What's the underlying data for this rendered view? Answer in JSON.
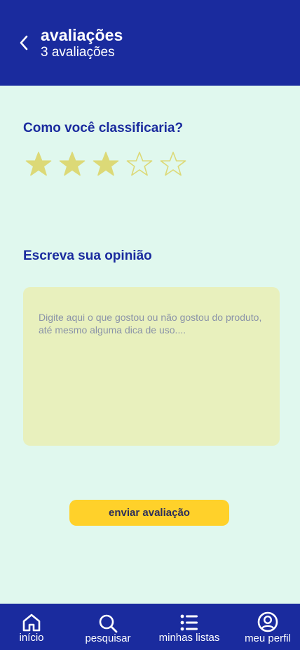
{
  "header": {
    "title": "avaliações",
    "subtitle": "3 avaliações"
  },
  "rating": {
    "question": "Como você classificaria?",
    "value": 3,
    "max": 5,
    "filled_color": "#DCD977",
    "empty_color": "#DCD977"
  },
  "opinion": {
    "title": "Escreva sua opinião",
    "placeholder": "Digite aqui o que gostou ou não gostou do produto, até mesmo alguma dica de uso....",
    "value": ""
  },
  "submit": {
    "label": "enviar avaliação"
  },
  "nav": {
    "items": [
      {
        "label": "início",
        "icon": "home-icon"
      },
      {
        "label": "pesquisar",
        "icon": "search-icon"
      },
      {
        "label": "minhas listas",
        "icon": "list-icon"
      },
      {
        "label": "meu perfil",
        "icon": "profile-icon"
      }
    ]
  },
  "colors": {
    "primary": "#1A2B9E",
    "background": "#E0F8EE",
    "accent": "#FFD12A",
    "textarea_bg": "#E8F0BD"
  }
}
